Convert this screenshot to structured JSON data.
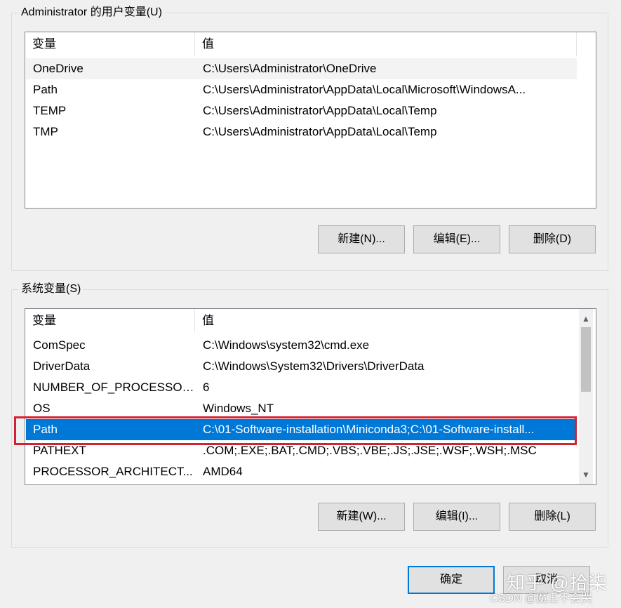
{
  "user_vars": {
    "title": "Administrator 的用户变量(U)",
    "header": {
      "var": "变量",
      "val": "值"
    },
    "rows": [
      {
        "name": "OneDrive",
        "value": "C:\\Users\\Administrator\\OneDrive"
      },
      {
        "name": "Path",
        "value": "C:\\Users\\Administrator\\AppData\\Local\\Microsoft\\WindowsA..."
      },
      {
        "name": "TEMP",
        "value": "C:\\Users\\Administrator\\AppData\\Local\\Temp"
      },
      {
        "name": "TMP",
        "value": "C:\\Users\\Administrator\\AppData\\Local\\Temp"
      }
    ],
    "buttons": {
      "new": "新建(N)...",
      "edit": "编辑(E)...",
      "delete": "删除(D)"
    }
  },
  "system_vars": {
    "title": "系统变量(S)",
    "header": {
      "var": "变量",
      "val": "值"
    },
    "rows": [
      {
        "name": "ComSpec",
        "value": "C:\\Windows\\system32\\cmd.exe"
      },
      {
        "name": "DriverData",
        "value": "C:\\Windows\\System32\\Drivers\\DriverData"
      },
      {
        "name": "NUMBER_OF_PROCESSORS",
        "value": "6"
      },
      {
        "name": "OS",
        "value": "Windows_NT"
      },
      {
        "name": "Path",
        "value": "C:\\01-Software-installation\\Miniconda3;C:\\01-Software-install..."
      },
      {
        "name": "PATHEXT",
        "value": ".COM;.EXE;.BAT;.CMD;.VBS;.VBE;.JS;.JSE;.WSF;.WSH;.MSC"
      },
      {
        "name": "PROCESSOR_ARCHITECT...",
        "value": "AMD64"
      }
    ],
    "selected_row": "Path",
    "buttons": {
      "new": "新建(W)...",
      "edit": "编辑(I)...",
      "delete": "删除(L)"
    }
  },
  "footer": {
    "ok": "确定",
    "cancel": "取消"
  },
  "watermark": {
    "line1": "知乎 @拾柒",
    "line2": "CSDN @魔王不会哭"
  },
  "colors": {
    "selection": "#0078d7",
    "highlight_box": "#d32232"
  }
}
